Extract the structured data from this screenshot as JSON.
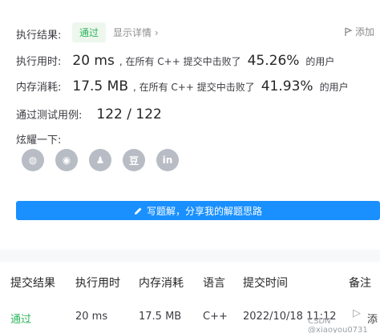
{
  "result": {
    "label": "执行结果:",
    "status": "通过",
    "detail_link": "显示详情",
    "add_note": "添加"
  },
  "runtime": {
    "label": "执行用时:",
    "value": "20 ms",
    "prefix": ", 在所有 C++ 提交中击败了",
    "percent": "45.26%",
    "suffix": "的用户"
  },
  "memory": {
    "label": "内存消耗:",
    "value": "17.5 MB",
    "prefix": ", 在所有 C++ 提交中击败了",
    "percent": "41.93%",
    "suffix": "的用户"
  },
  "testcases": {
    "label": "通过测试用例:",
    "value": "122 / 122"
  },
  "share": {
    "label": "炫耀一下:",
    "icons": [
      "wechat-icon",
      "weibo-icon",
      "qq-icon",
      "douban-icon",
      "linkedin-icon"
    ],
    "icon_glyphs": [
      "◍",
      "◉",
      "♟",
      "豆",
      "in"
    ]
  },
  "write_button": "写题解，分享我的解题思路",
  "table": {
    "headers": [
      "提交结果",
      "执行用时",
      "内存消耗",
      "语言",
      "提交时间",
      "备注"
    ],
    "row": [
      "通过",
      "20 ms",
      "17.5 MB",
      "C++",
      "2022/10/18 11:12",
      "添"
    ]
  },
  "watermark": "CSDN @xiaoyou0731",
  "colors": {
    "accent": "#1a90ff",
    "success": "#2db55d",
    "icon_gray": "#b8bcc4"
  }
}
